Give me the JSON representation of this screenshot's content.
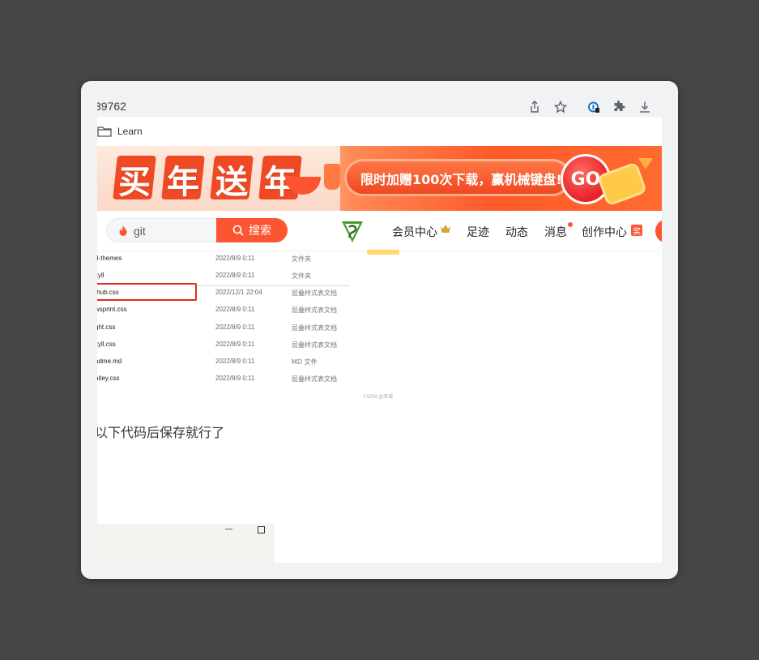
{
  "browser": {
    "url_fragment": "39762",
    "bookmark_label": "Learn"
  },
  "banner": {
    "chars": [
      "买",
      "年",
      "送",
      "年"
    ],
    "promo_text": "限时加赠100次下载，赢机械键盘!",
    "go_label": "GO"
  },
  "header": {
    "search_value": "git",
    "search_button": "搜索",
    "nav": {
      "vip": "会员中心",
      "footprints": "足迹",
      "activity": "动态",
      "messages": "消息",
      "creator": "创作中心",
      "creator_badge": "奖"
    }
  },
  "files": [
    {
      "name": "d-themes",
      "date": "2022/8/9 0:11",
      "type": "文件夹"
    },
    {
      "name": "kyll",
      "date": "2022/8/9 0:11",
      "type": "文件夹"
    },
    {
      "name": "thub.css",
      "date": "2022/12/1 22:04",
      "type": "层叠样式表文档"
    },
    {
      "name": "wsprint.css",
      "date": "2022/8/9 0:11",
      "type": "层叠样式表文档"
    },
    {
      "name": "ght.css",
      "date": "2022/8/9 0:11",
      "type": "层叠样式表文档"
    },
    {
      "name": "kyll.css",
      "date": "2022/8/9 0:11",
      "type": "层叠样式表文档"
    },
    {
      "name": "adme.md",
      "date": "2022/8/9 0:11",
      "type": "MD 文件"
    },
    {
      "name": "nitey.css",
      "date": "2022/8/9 0:11",
      "type": "层叠样式表文档"
    }
  ],
  "watermark": "CSDN @亚城",
  "body_text": "以下代码后保存就行了",
  "colors": {
    "accent": "#fc5531",
    "page_bg": "#464646",
    "selection": "#e8271f"
  },
  "icons": [
    "share-icon",
    "star-icon",
    "password-key-icon",
    "extension-icon",
    "download-icon",
    "folder-icon",
    "flame-icon",
    "search-icon",
    "crown-icon",
    "minimize-icon",
    "maximize-icon"
  ]
}
